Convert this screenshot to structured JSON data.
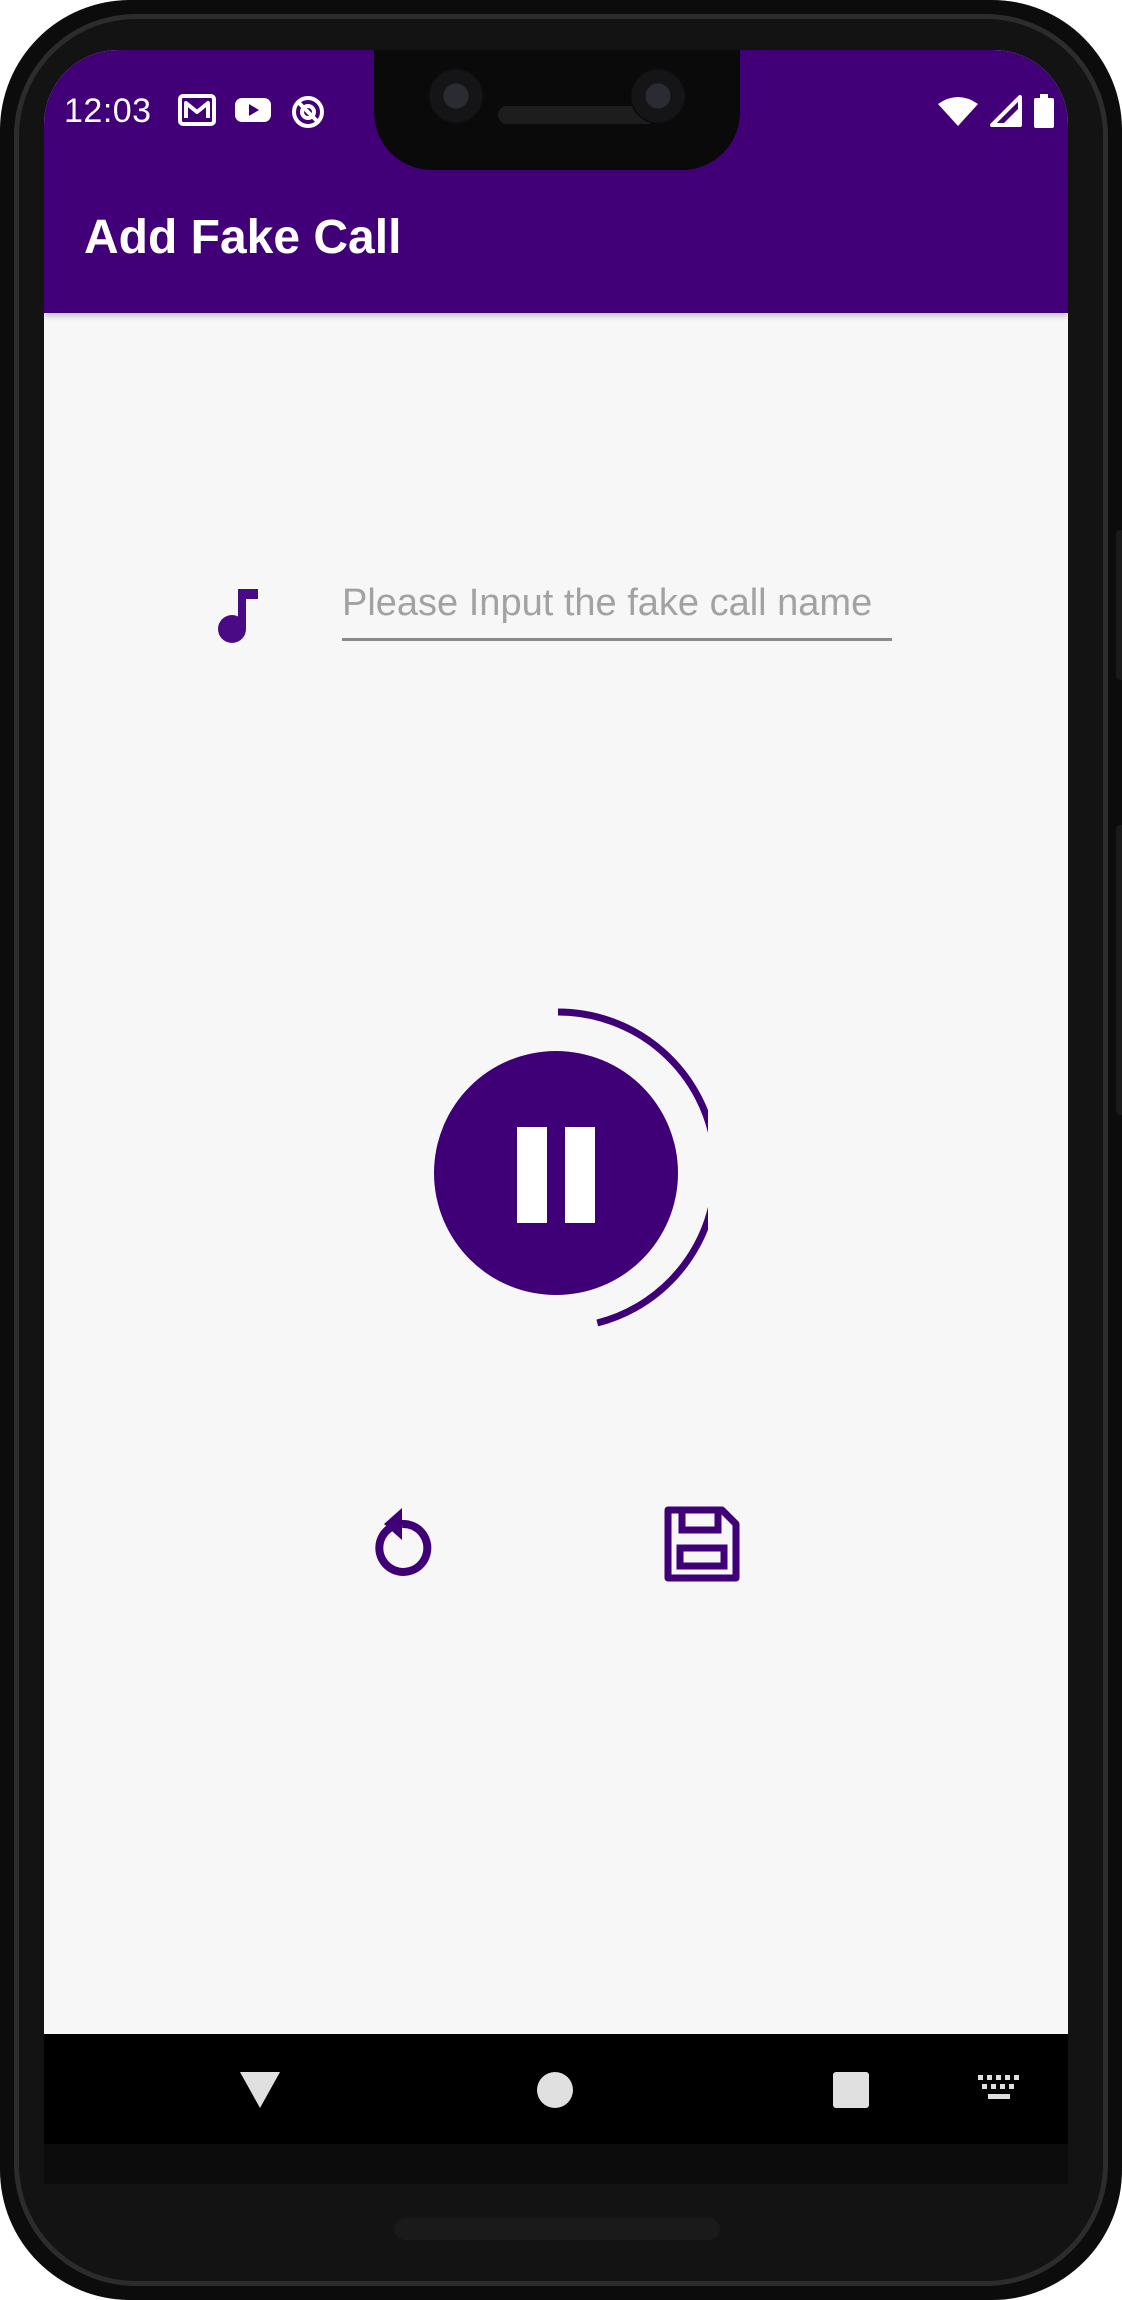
{
  "status_bar": {
    "time": "12:03",
    "left_icons": [
      "gmail-icon",
      "youtube-icon",
      "sync-icon"
    ],
    "right_icons": [
      "wifi-icon",
      "signal-icon",
      "battery-icon"
    ]
  },
  "app_bar": {
    "title": "Add Fake Call",
    "color": "#410078"
  },
  "form": {
    "icon": "music-note-icon",
    "name_value": "",
    "name_placeholder": "Please Input the fake call name"
  },
  "recorder": {
    "state_icon": "pause-icon",
    "button_color": "#3f0077",
    "progress_fraction": 0.46
  },
  "actions": {
    "reset_icon": "replay-icon",
    "save_icon": "save-icon"
  },
  "nav_bar": {
    "icons": [
      "back-icon",
      "home-icon",
      "recents-icon",
      "keyboard-icon"
    ]
  },
  "colors": {
    "primary": "#410078",
    "background": "#f7f7f8"
  }
}
